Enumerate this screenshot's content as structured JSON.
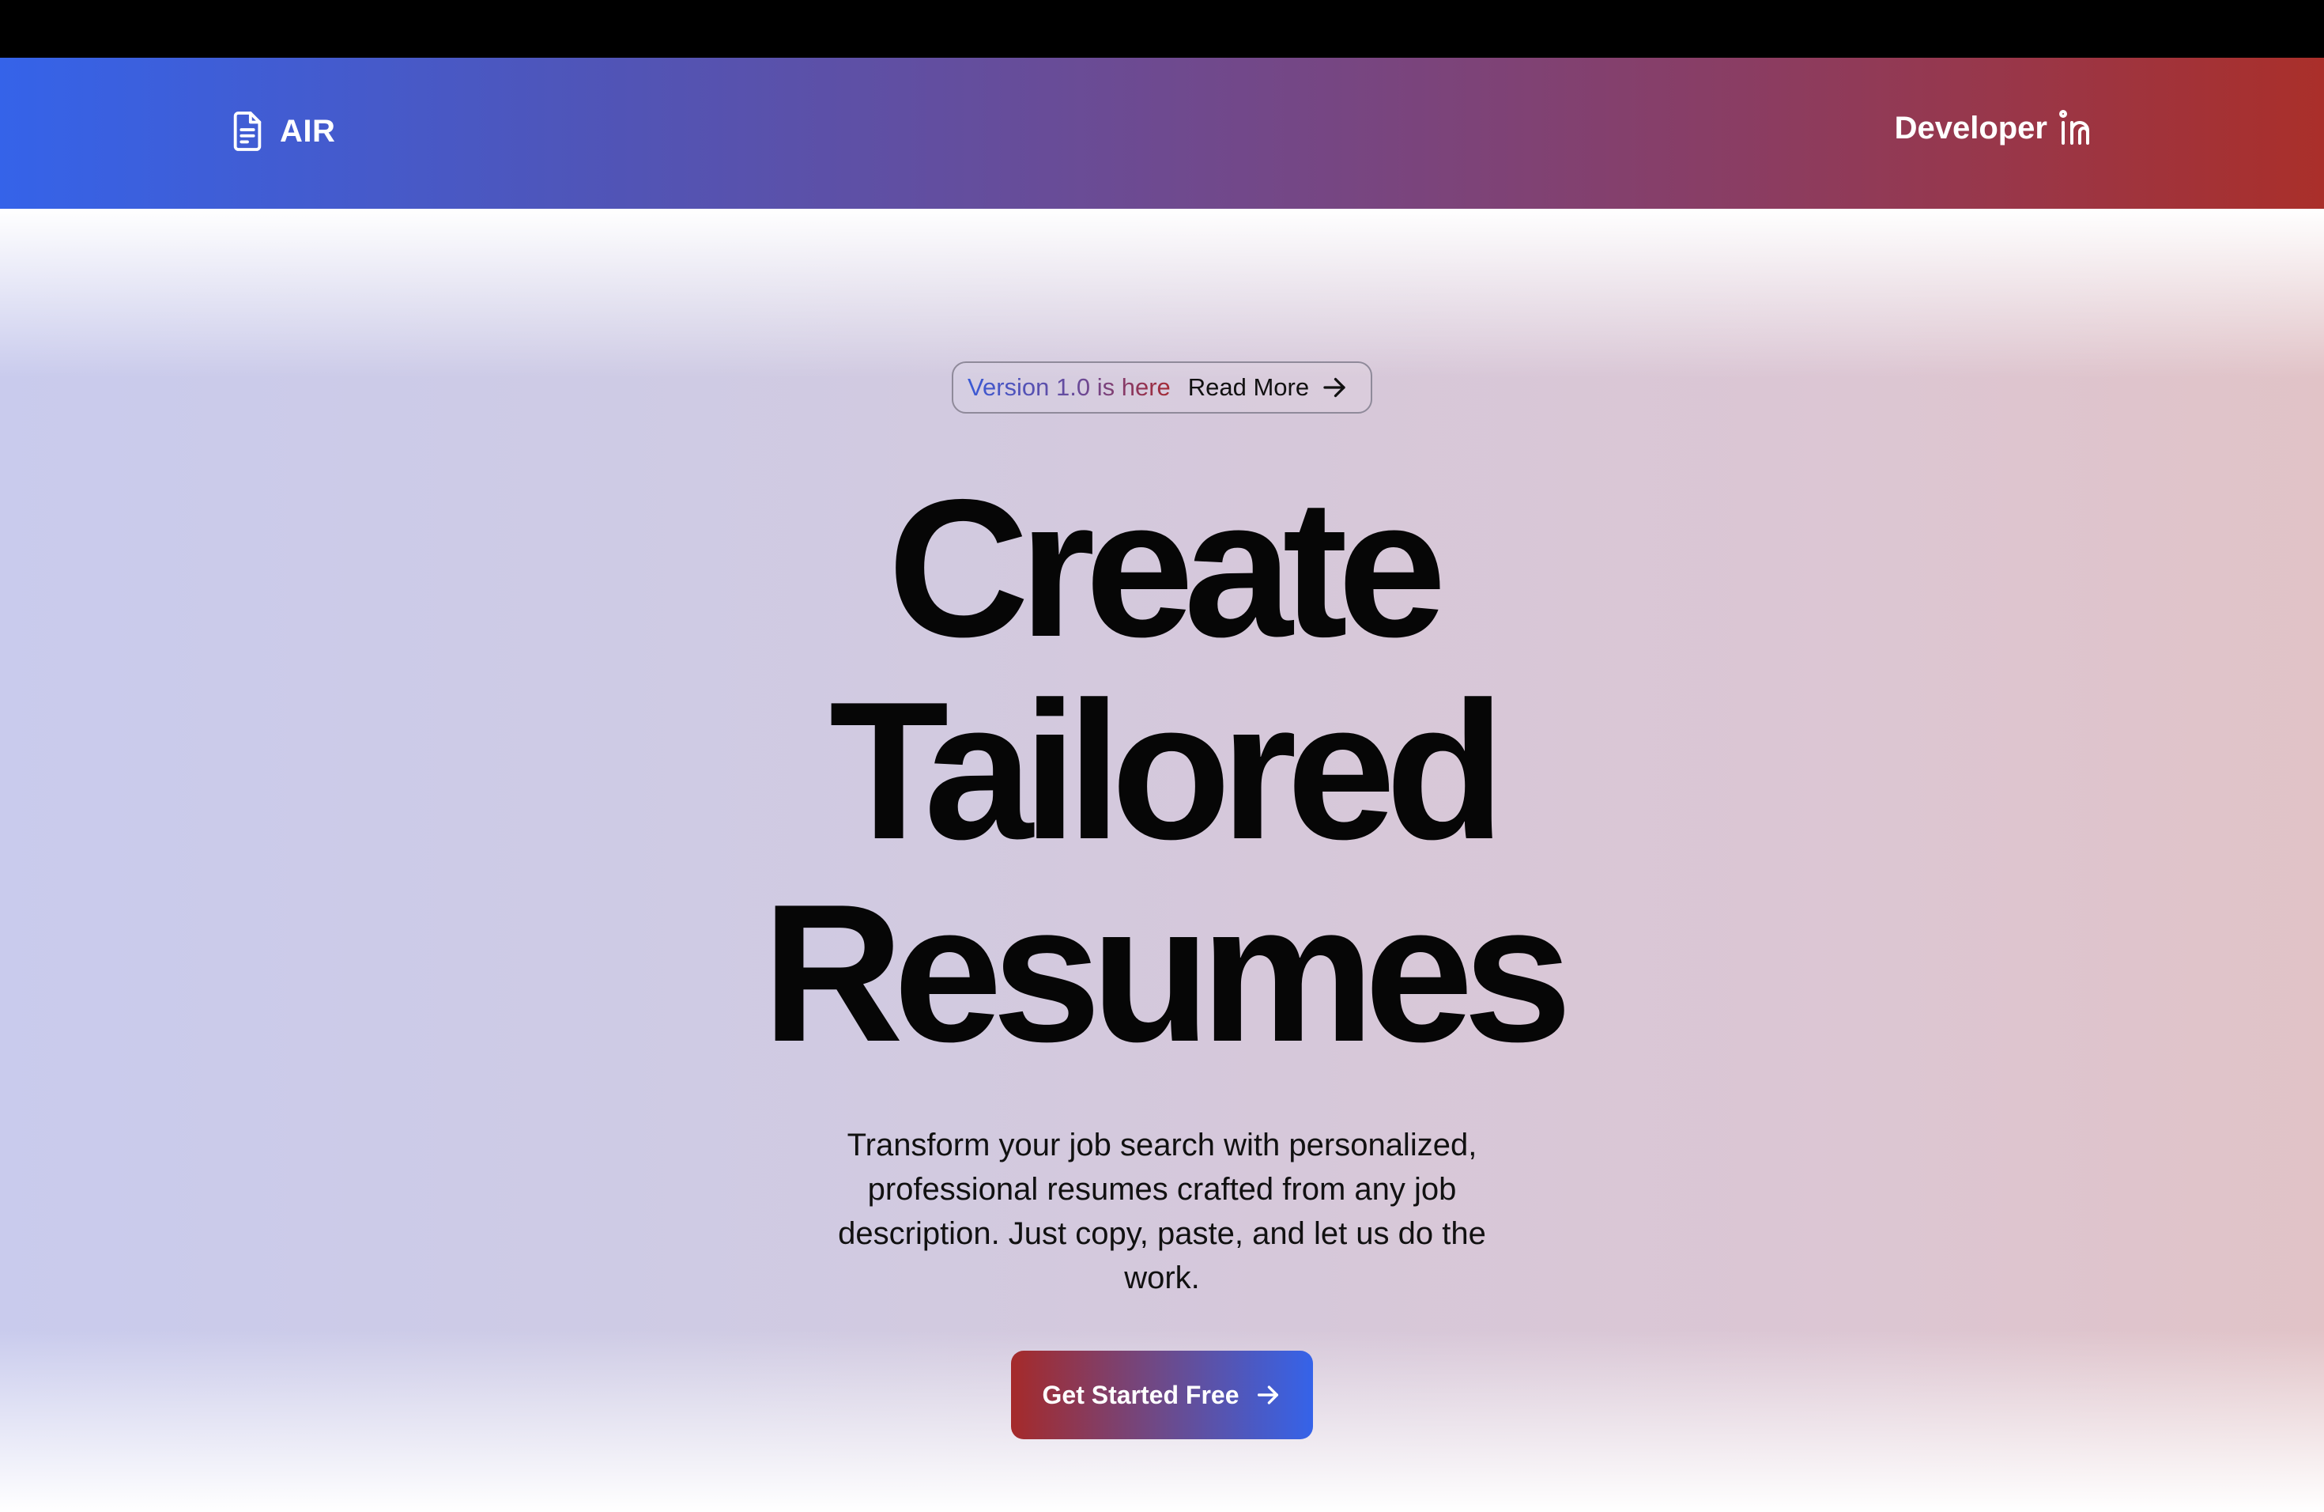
{
  "header": {
    "brand_icon": "document-icon",
    "brand_name": "AIR",
    "developer_label": "Developer",
    "developer_icon": "linkedin-icon"
  },
  "colors": {
    "nav_gradient_start": "#3563e9",
    "nav_gradient_end": "#aa2f2a",
    "cta_gradient_start": "#a52a2a",
    "cta_gradient_end": "#3563e9"
  },
  "hero": {
    "badge": {
      "version_text": "Version 1.0 is here",
      "link_label": "Read More",
      "link_icon": "arrow-right-icon"
    },
    "headline": [
      "Create",
      "Tailored",
      "Resumes"
    ],
    "subtitle": "Transform your job search with personalized, professional resumes crafted from any job description. Just copy, paste, and let us do the work.",
    "cta": {
      "label": "Get Started Free",
      "icon": "arrow-right-icon"
    }
  }
}
